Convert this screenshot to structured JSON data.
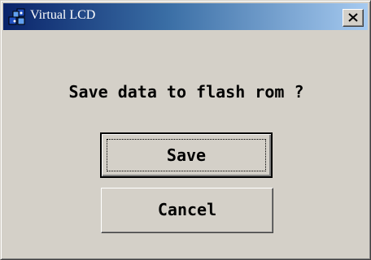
{
  "window": {
    "title": "Virtual LCD",
    "app_icon": "virtual-lcd-app-icon",
    "close_icon": "close-icon"
  },
  "dialog": {
    "message": "Save data to flash rom ?",
    "save_label": "Save",
    "cancel_label": "Cancel",
    "default_button": "Save"
  },
  "colors": {
    "titlebar_start": "#0a246a",
    "titlebar_end": "#a6caf0",
    "face": "#d4d0c8",
    "text": "#000000"
  }
}
